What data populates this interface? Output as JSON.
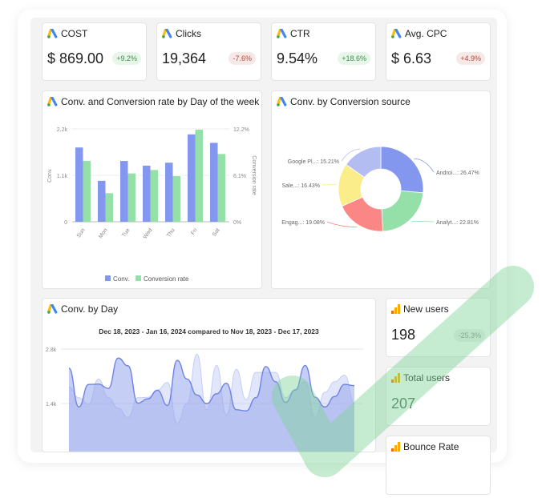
{
  "kpis": [
    {
      "title": "COST",
      "value": "$ 869.00",
      "change": "+9.2%",
      "trend": "up"
    },
    {
      "title": "Clicks",
      "value": "19,364",
      "change": "-7.6%",
      "trend": "down"
    },
    {
      "title": "CTR",
      "value": "9.54%",
      "change": "+18.6%",
      "trend": "up"
    },
    {
      "title": "Avg. CPC",
      "value": "$ 6.63",
      "change": "+4.9%",
      "trend": "down"
    }
  ],
  "side_cards": [
    {
      "title": "New users",
      "value": "198",
      "change": "-25.3%"
    },
    {
      "title": "Total users",
      "value": "207"
    },
    {
      "title": "Bounce Rate"
    }
  ],
  "colors": {
    "conv": "#8497ee",
    "rate": "#94e0a8",
    "up": "#3c8a4a",
    "down": "#b04a3a",
    "check": "#7fd39a"
  },
  "chart_data": [
    {
      "type": "bar",
      "title": "Conv. and Conversion rate by Day of the week",
      "categories": [
        "Sun",
        "Mon",
        "Tue",
        "Wed",
        "Thu",
        "Fri",
        "Sat"
      ],
      "series": [
        {
          "name": "Conv.",
          "axis": "left",
          "values": [
            1760,
            970,
            1440,
            1330,
            1400,
            2070,
            1870
          ]
        },
        {
          "name": "Conversion rate",
          "axis": "right",
          "values": [
            8.0,
            3.75,
            6.35,
            6.8,
            6.0,
            12.1,
            8.9
          ]
        }
      ],
      "ylabel": "Conv.",
      "y2label": "Conversion rate",
      "ylim": [
        0,
        2200
      ],
      "y2lim": [
        0,
        12.2
      ],
      "yticks": [
        "0",
        "1.1k",
        "2.2k"
      ],
      "y2ticks": [
        "0%",
        "6.1%",
        "12.2%"
      ],
      "legend": "bottom"
    },
    {
      "type": "pie",
      "title": "Conv. by Conversion source",
      "donut": true,
      "slices": [
        {
          "label": "Androi...",
          "value": 26.47,
          "color": "#8497ee"
        },
        {
          "label": "Analyt...",
          "value": 22.81,
          "color": "#94e0a8"
        },
        {
          "label": "Engag...",
          "value": 19.08,
          "color": "#fb8686"
        },
        {
          "label": "Sale...",
          "value": 16.43,
          "color": "#fbee8a"
        },
        {
          "label": "Google Pl...",
          "value": 15.21,
          "color": "#b3bdf2"
        }
      ]
    },
    {
      "type": "area",
      "title": "Conv. by Day",
      "subtitle": "Dec 18, 2023 - Jan 16, 2024 compared to Nov 18, 2023 - Dec 17, 2023",
      "yticks": [
        "1.4k",
        "2.8k"
      ],
      "ylim": [
        0,
        2800
      ],
      "series": [
        {
          "values": [
            2310,
            1310,
            1890,
            1900,
            1790,
            2570,
            2370,
            1410,
            1520,
            1740,
            1350,
            2510,
            2030,
            1620,
            1400,
            1650,
            1920,
            1240,
            1210,
            1550,
            2350,
            1960,
            1430,
            1750,
            2380,
            1560,
            1310,
            1580,
            1890,
            1860
          ]
        },
        {
          "comparison": true,
          "values": [
            1820,
            1550,
            1380,
            2030,
            1550,
            1280,
            1040,
            1550,
            1560,
            1750,
            1940,
            900,
            1410,
            2670,
            1240,
            2380,
            1110,
            2280,
            1500,
            2200,
            2200,
            2200,
            1550,
            1750,
            1960,
            1040,
            1690,
            1960,
            2130,
            1410
          ]
        }
      ]
    }
  ]
}
